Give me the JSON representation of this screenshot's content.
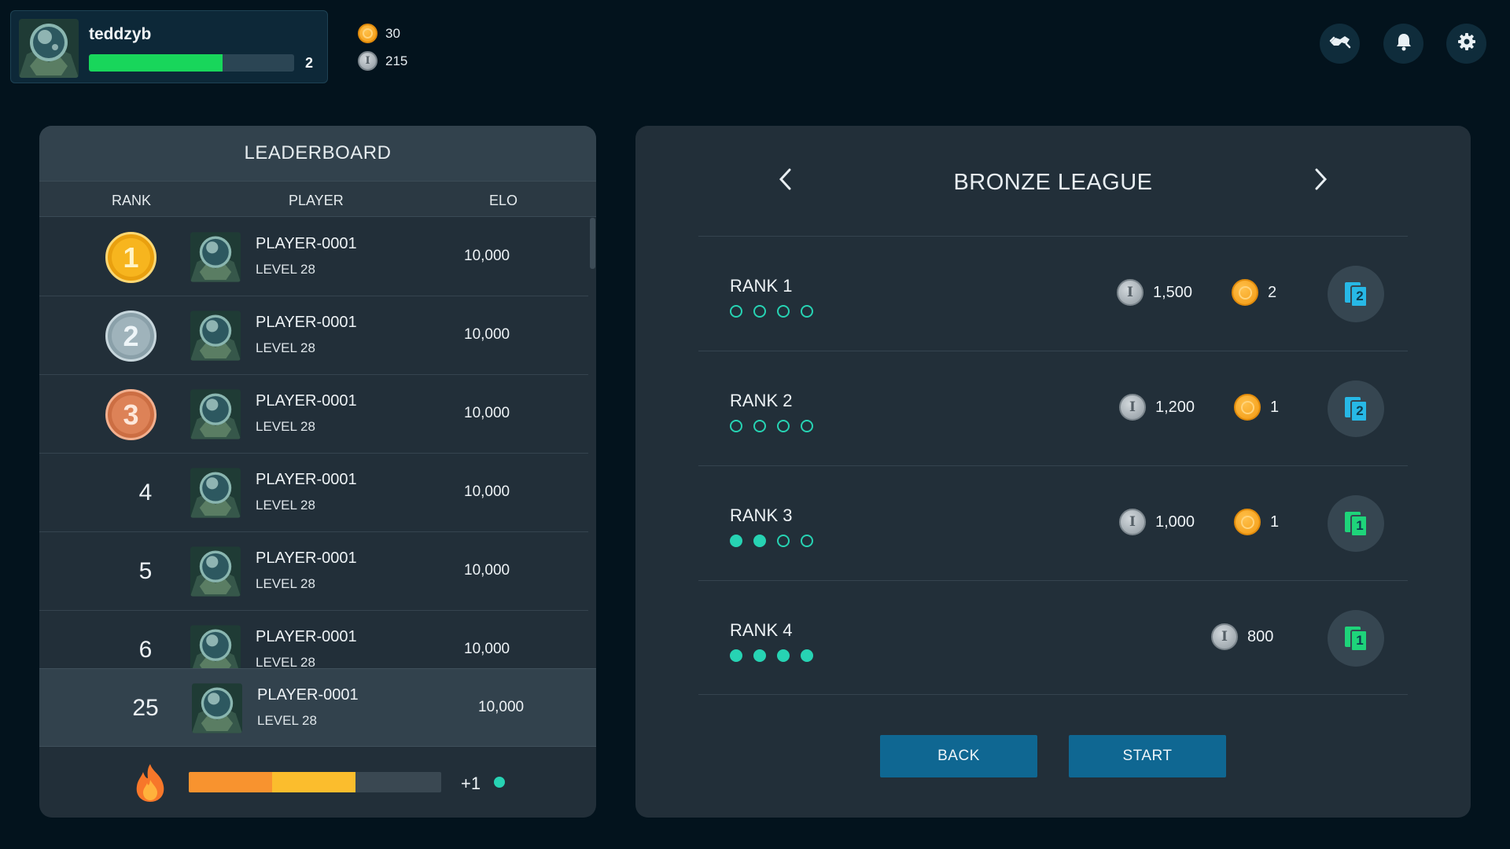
{
  "player": {
    "username": "teddzyb",
    "level": "2",
    "xp_progress": 0.65,
    "avatar_icon": "alien-avatar"
  },
  "currency": {
    "gold": "30",
    "silver": "215"
  },
  "top_buttons": [
    "trade-icon",
    "bell-icon",
    "gear-icon"
  ],
  "leaderboard": {
    "title": "LEADERBOARD",
    "headers": {
      "rank": "RANK",
      "player": "PLAYER",
      "elo": "ELO"
    },
    "rows": [
      {
        "rank": "1",
        "medal": "gold",
        "name": "PLAYER-0001",
        "level": "LEVEL 28",
        "elo": "10,000"
      },
      {
        "rank": "2",
        "medal": "silver",
        "name": "PLAYER-0001",
        "level": "LEVEL 28",
        "elo": "10,000"
      },
      {
        "rank": "3",
        "medal": "bronze",
        "name": "PLAYER-0001",
        "level": "LEVEL 28",
        "elo": "10,000"
      },
      {
        "rank": "4",
        "medal": "",
        "name": "PLAYER-0001",
        "level": "LEVEL 28",
        "elo": "10,000"
      },
      {
        "rank": "5",
        "medal": "",
        "name": "PLAYER-0001",
        "level": "LEVEL 28",
        "elo": "10,000"
      },
      {
        "rank": "6",
        "medal": "",
        "name": "PLAYER-0001",
        "level": "LEVEL 28",
        "elo": "10,000"
      }
    ],
    "me": {
      "rank": "25",
      "name": "PLAYER-0001",
      "level": "LEVEL 28",
      "elo": "10,000"
    },
    "streak": {
      "segment1": 0.33,
      "segment2": 0.33,
      "bonus": "+1"
    }
  },
  "league": {
    "title": "BRONZE LEAGUE",
    "ranks": [
      {
        "label": "RANK 1",
        "filled": 0,
        "silver": "1,500",
        "gold": "2",
        "card": "2",
        "card_color": "#27b8e6"
      },
      {
        "label": "RANK 2",
        "filled": 0,
        "silver": "1,200",
        "gold": "1",
        "card": "2",
        "card_color": "#27b8e6"
      },
      {
        "label": "RANK 3",
        "filled": 2,
        "silver": "1,000",
        "gold": "1",
        "card": "1",
        "card_color": "#1ed47a"
      },
      {
        "label": "RANK 4",
        "filled": 4,
        "silver": "800",
        "gold": "",
        "card": "1",
        "card_color": "#1ed47a"
      }
    ],
    "back_label": "BACK",
    "start_label": "START"
  },
  "colors": {
    "accent_teal": "#27d3b3",
    "xp_green": "#18d65b",
    "button_blue": "#0f6792"
  }
}
